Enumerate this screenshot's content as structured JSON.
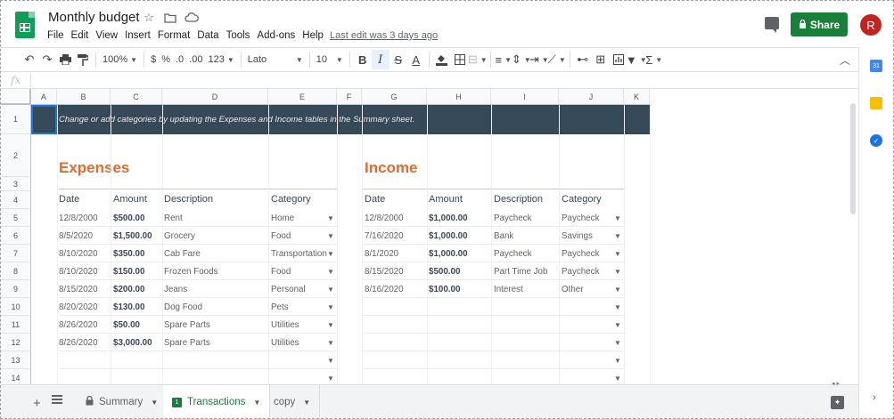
{
  "app": {
    "doc_title": "Monthly budget",
    "menu": [
      "File",
      "Edit",
      "View",
      "Insert",
      "Format",
      "Data",
      "Tools",
      "Add-ons",
      "Help"
    ],
    "last_edit": "Last edit was 3 days ago",
    "share_label": "Share",
    "avatar_letter": "R"
  },
  "toolbar": {
    "zoom": "100%",
    "currency": "$",
    "percent": "%",
    "dec_less": ".0",
    "dec_more": ".00",
    "format_more": "123",
    "font": "Lato",
    "font_size": "10",
    "bold": "B",
    "italic": "I",
    "strike": "S",
    "text_color": "A",
    "functions": "Σ"
  },
  "formula_bar": {
    "fx": "fx",
    "value": ""
  },
  "columns": [
    "A",
    "B",
    "C",
    "D",
    "E",
    "F",
    "G",
    "H",
    "I",
    "J",
    "K"
  ],
  "rows": [
    "1",
    "2",
    "3",
    "4",
    "5",
    "6",
    "7",
    "8",
    "9",
    "10",
    "11",
    "12",
    "13",
    "14"
  ],
  "banner": "Change or add categories by updating the Expenses and Income tables in the Summary sheet.",
  "expenses": {
    "title": "Expenses",
    "headers": [
      "Date",
      "Amount",
      "Description",
      "Category"
    ],
    "rows": [
      [
        "12/8/2000",
        "$500.00",
        "Rent",
        "Home"
      ],
      [
        "8/5/2020",
        "$1,500.00",
        "Grocery",
        "Food"
      ],
      [
        "8/10/2020",
        "$350.00",
        "Cab Fare",
        "Transportation"
      ],
      [
        "8/10/2020",
        "$150.00",
        "Frozen Foods",
        "Food"
      ],
      [
        "8/15/2020",
        "$200.00",
        "Jeans",
        "Personal"
      ],
      [
        "8/20/2020",
        "$130.00",
        "Dog Food",
        "Pets"
      ],
      [
        "8/26/2020",
        "$50.00",
        "Spare Parts",
        "Utilities"
      ],
      [
        "8/26/2020",
        "$3,000.00",
        "Spare Parts",
        "Utilities"
      ]
    ]
  },
  "income": {
    "title": "Income",
    "headers": [
      "Date",
      "Amount",
      "Description",
      "Category"
    ],
    "rows": [
      [
        "12/8/2000",
        "$1,000.00",
        "Paycheck",
        "Paycheck"
      ],
      [
        "7/16/2020",
        "$1,000.00",
        "Bank",
        "Savings"
      ],
      [
        "8/1/2020",
        "$1,000.00",
        "Paycheck",
        "Paycheck"
      ],
      [
        "8/15/2020",
        "$500.00",
        "Part Time Job",
        "Paycheck"
      ],
      [
        "8/16/2020",
        "$100.00",
        "Interest",
        "Other"
      ]
    ]
  },
  "tabs": [
    {
      "label": "Summary",
      "locked": true,
      "active": false
    },
    {
      "label": "Transactions",
      "locked": false,
      "active": true
    },
    {
      "label": "copy",
      "locked": false,
      "active": false
    }
  ],
  "colors": {
    "accent": "#e8692a",
    "banner": "#364959",
    "share": "#188038"
  }
}
